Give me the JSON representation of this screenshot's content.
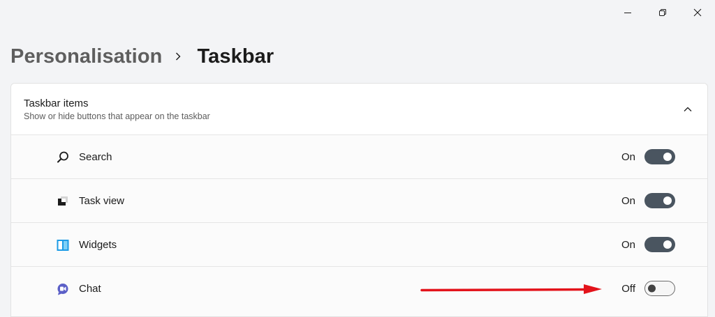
{
  "breadcrumb": {
    "parent": "Personalisation",
    "current": "Taskbar"
  },
  "section": {
    "title": "Taskbar items",
    "subtitle": "Show or hide buttons that appear on the taskbar"
  },
  "items": [
    {
      "label": "Search",
      "state": "On",
      "enabled": true,
      "icon": "search-icon"
    },
    {
      "label": "Task view",
      "state": "On",
      "enabled": true,
      "icon": "task-view-icon"
    },
    {
      "label": "Widgets",
      "state": "On",
      "enabled": true,
      "icon": "widgets-icon"
    },
    {
      "label": "Chat",
      "state": "Off",
      "enabled": false,
      "icon": "chat-icon"
    }
  ],
  "colors": {
    "toggle_on": "#4a5560",
    "annotation_arrow": "#e3131b",
    "widgets_icon": "#1c9be6",
    "chat_icon": "#5b5fc7"
  }
}
